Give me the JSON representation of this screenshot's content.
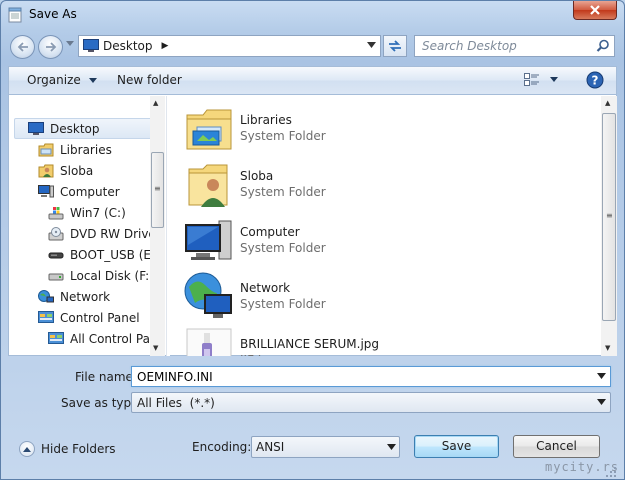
{
  "window": {
    "title": "Save As",
    "close_label": "✕"
  },
  "nav": {
    "address": "Desktop",
    "search_placeholder": "Search Desktop"
  },
  "toolbar": {
    "organize_label": "Organize",
    "new_folder_label": "New folder"
  },
  "tree": {
    "items": [
      {
        "label": "Desktop",
        "icon": "desktop-icon"
      },
      {
        "label": "Libraries",
        "icon": "libraries-icon"
      },
      {
        "label": "Sloba",
        "icon": "user-folder-icon"
      },
      {
        "label": "Computer",
        "icon": "computer-icon"
      },
      {
        "label": "Win7 (C:)",
        "icon": "windows-drive-icon"
      },
      {
        "label": "DVD RW Drive (",
        "icon": "dvd-drive-icon"
      },
      {
        "label": "BOOT_USB (E:)",
        "icon": "usb-drive-icon"
      },
      {
        "label": "Local Disk (F:)",
        "icon": "hard-drive-icon"
      },
      {
        "label": "Network",
        "icon": "network-icon"
      },
      {
        "label": "Control Panel",
        "icon": "control-panel-icon"
      },
      {
        "label": "All Control Pan",
        "icon": "control-panel-icon"
      }
    ]
  },
  "files": [
    {
      "name": "Libraries",
      "type": "System Folder",
      "icon": "libraries-icon"
    },
    {
      "name": "Sloba",
      "type": "System Folder",
      "icon": "user-folder-icon"
    },
    {
      "name": "Computer",
      "type": "System Folder",
      "icon": "computer-icon"
    },
    {
      "name": "Network",
      "type": "System Folder",
      "icon": "network-icon"
    },
    {
      "name": "BRILLIANCE SERUM.jpg",
      "type": "JIF Image",
      "icon": "image-file-icon"
    }
  ],
  "form": {
    "filename_label": "File name:",
    "filename_value": "OEMINFO.INI",
    "savetype_label": "Save as type:",
    "savetype_value": "All Files  (*.*)",
    "hide_folders_label": "Hide Folders",
    "encoding_label": "Encoding:",
    "encoding_value": "ANSI",
    "save_label": "Save",
    "cancel_label": "Cancel"
  },
  "watermark": "mycity.rs"
}
